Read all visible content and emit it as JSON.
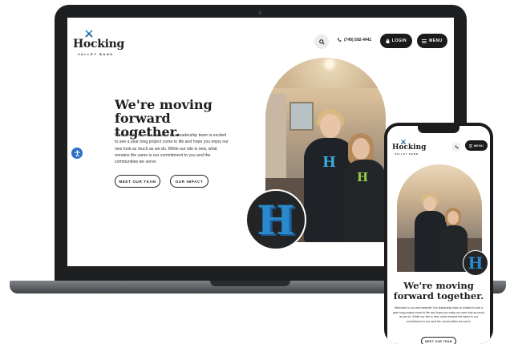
{
  "brand": {
    "name": "Hocking",
    "tagline": "VALLEY BANK"
  },
  "header": {
    "phone": "(740) 592-4441",
    "login_label": "LOGIN",
    "menu_label": "MENU"
  },
  "hero": {
    "headline": "We're moving forward together.",
    "body": "Welcome to our new website! Our leadership team is excited to see a year long project come to life and hope you enjoy our new look as much as we do. While our site is new, what remains the same is our commitment to you and the communities we serve.",
    "buttons": [
      {
        "label": "MEET OUR TEAM"
      },
      {
        "label": "OUR IMPACT"
      }
    ],
    "badge_letter": "H"
  },
  "mobile": {
    "menu_label": "MENU",
    "headline": "We're moving forward together.",
    "body": "Welcome to our new website! Our leadership team is excited to see a year long project come to life and hope you enjoy our new look as much as we do. While our site is new, what remains the same is our commitment to you and the communities we serve.",
    "button_label": "MEET OUR TEAM"
  },
  "colors": {
    "accent_blue": "#2a89cc",
    "accent_green": "#9acd45",
    "button_dark": "#1b1b1b",
    "accessibility_blue": "#2c6fc4"
  },
  "icons": [
    "search-icon",
    "phone-icon",
    "lock-icon",
    "menu-icon",
    "accessibility-icon"
  ]
}
